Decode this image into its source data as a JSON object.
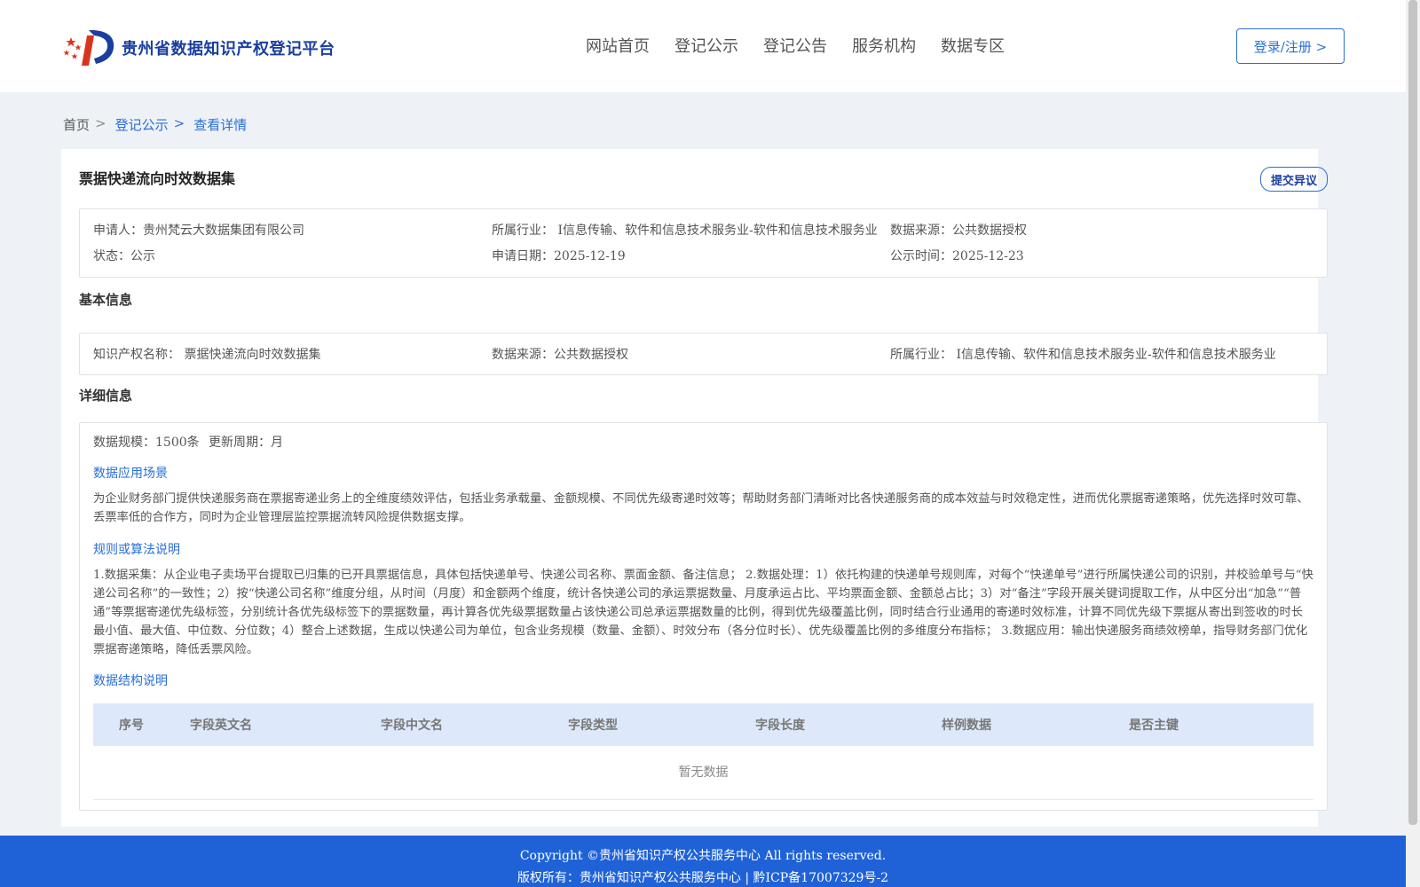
{
  "header": {
    "brand": "贵州省数据知识产权登记平台",
    "nav": [
      "网站首页",
      "登记公示",
      "登记公告",
      "服务机构",
      "数据专区"
    ],
    "login_label": "登录/注册 >"
  },
  "breadcrumb": {
    "home": "首页",
    "sep": ">",
    "level1": "登记公示",
    "level2": "查看详情"
  },
  "dataset": {
    "title": "票据快递流向时效数据集",
    "objection_label": "提交异议",
    "summary": {
      "applicant": "申请人：贵州梵云大数据集团有限公司",
      "industry": "所属行业：  I信息传输、软件和信息技术服务业-软件和信息技术服务业",
      "source": "数据来源：公共数据授权",
      "status": "状态：公示",
      "apply_date": "申请日期：2025-12-19",
      "publish_date": "公示时间：2025-12-23"
    },
    "basic_heading": "基本信息",
    "basic": {
      "ip_name": "知识产权名称：  票据快递流向时效数据集",
      "source": "数据来源：公共数据授权",
      "industry": "所属行业：  I信息传输、软件和信息技术服务业-软件和信息技术服务业"
    },
    "detail_heading": "详细信息",
    "detail": {
      "scale": "数据规模：1500条",
      "cycle": "更新周期：月",
      "scene_heading": "数据应用场景",
      "scene_text": "为企业财务部门提供快递服务商在票据寄递业务上的全维度绩效评估，包括业务承载量、金额规模、不同优先级寄递时效等；帮助财务部门清晰对比各快递服务商的成本效益与时效稳定性，进而优化票据寄递策略，优先选择时效可靠、丢票率低的合作方，同时为企业管理层监控票据流转风险提供数据支撑。",
      "rule_heading": "规则或算法说明",
      "rule_text": "1.数据采集：从企业电子卖场平台提取已归集的已开具票据信息，具体包括快递单号、快递公司名称、票面金额、备注信息； 2.数据处理：1）依托构建的快递单号规则库，对每个“快递单号”进行所属快递公司的识别，并校验单号与“快递公司名称”的一致性；2）按“快递公司名称”维度分组，从时间（月度）和金额两个维度，统计各快递公司的承运票据数量、月度承运占比、平均票面金额、金额总占比；3）对“备注”字段开展关键词提取工作，从中区分出“加急”“普通”等票据寄递优先级标签，分别统计各优先级标签下的票据数量，再计算各优先级票据数量占该快递公司总承运票据数量的比例，得到优先级覆盖比例，同时结合行业通用的寄递时效标准，计算不同优先级下票据从寄出到签收的时长最小值、最大值、中位数、分位数；4）整合上述数据，生成以快递公司为单位，包含业务规模（数量、金额）、时效分布（各分位时长）、优先级覆盖比例的多维度分布指标； 3.数据应用：输出快递服务商绩效榜单，指导财务部门优化票据寄递策略，降低丢票风险。",
      "structure_heading": "数据结构说明",
      "table_columns": [
        "序号",
        "字段英文名",
        "字段中文名",
        "字段类型",
        "字段长度",
        "样例数据",
        "是否主键"
      ],
      "empty_text": "暂无数据"
    }
  },
  "footer": {
    "copyright": "Copyright ©贵州省知识产权公共服务中心 All rights reserved.",
    "record": "版权所有：贵州省知识产权公共服务中心 | 黔ICP备17007329号-2"
  },
  "colors": {
    "brand_blue": "#1a3fa0",
    "link_blue": "#2a6fd6",
    "footer_blue": "#1f62d8",
    "table_header": "#dde9fa"
  }
}
